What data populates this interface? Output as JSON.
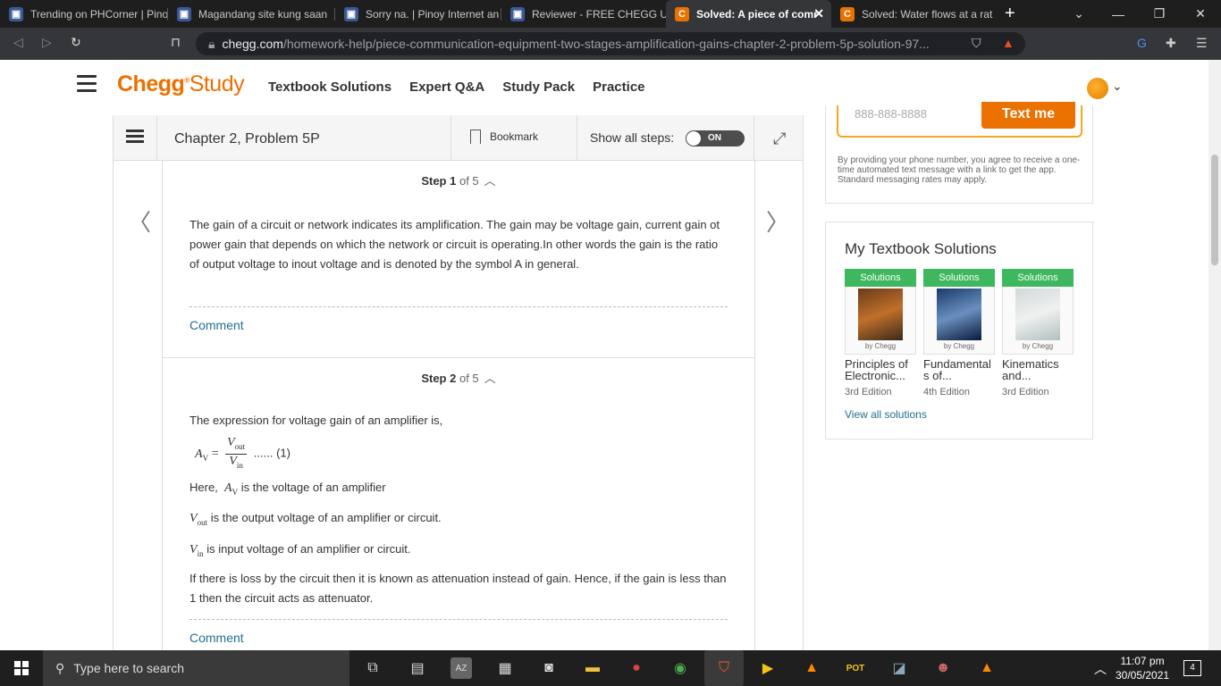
{
  "browser": {
    "tabs": [
      {
        "title": "Trending on PHCorner | Pinoy",
        "favicon": "phcorner-icon"
      },
      {
        "title": "Magandang site kung saan",
        "favicon": "phcorner-icon"
      },
      {
        "title": "Sorry na. | Pinoy Internet an",
        "favicon": "phcorner-icon"
      },
      {
        "title": "Reviewer - FREE CHEGG UN",
        "favicon": "phcorner-icon"
      },
      {
        "title": "Solved: A piece of comm",
        "favicon": "chegg-icon",
        "active": true
      },
      {
        "title": "Solved: Water flows at a rat",
        "favicon": "chegg-icon"
      }
    ],
    "url_domain": "chegg.com",
    "url_path": "/homework-help/piece-communication-equipment-two-stages-amplification-gains-chapter-2-problem-5p-solution-97..."
  },
  "header": {
    "logo_main": "Chegg",
    "logo_sub": "Study",
    "nav": [
      "Textbook Solutions",
      "Expert Q&A",
      "Study Pack",
      "Practice"
    ]
  },
  "solution_bar": {
    "chapter": "Chapter 2, Problem 5P",
    "bookmark": "Bookmark",
    "show_all_steps": "Show all steps:",
    "toggle": "ON"
  },
  "steps": [
    {
      "label": "Step",
      "num": "1",
      "of": "of 5",
      "body": "The gain of a circuit or network indicates its amplification. The gain may be voltage gain, current gain ot power gain that depends on which the network or circuit is operating.In other words the gain is the ratio of output voltage to inout voltage and is denoted by the symbol A in general.",
      "comment": "Comment"
    },
    {
      "label": "Step",
      "num": "2",
      "of": "of 5",
      "intro": "The expression for voltage gain of an amplifier is,",
      "eq_lhs": "A",
      "eq_lhs_sub": "V",
      "eq_num": "V",
      "eq_num_sub": "out",
      "eq_den": "V",
      "eq_den_sub": "in",
      "eq_tag": "...... (1)",
      "here_prefix": "Here,",
      "line1": "is the voltage of an amplifier",
      "line2": "is the output voltage of an amplifier or circuit.",
      "line3": "is input voltage of an amplifier or circuit.",
      "outro": "If there is loss by the circuit then it is known as attenuation instead of gain. Hence, if the gain is less than 1 then the circuit acts as attenuator.",
      "comment": "Comment"
    }
  ],
  "sidebar": {
    "phone_placeholder": "888-888-8888",
    "text_me": "Text me",
    "disclaimer": "By providing your phone number, you agree to receive a one-time automated text message with a link to get the app. Standard messaging rates may apply.",
    "my_solutions_title": "My Textbook Solutions",
    "books": [
      {
        "badge": "Solutions",
        "by": "by Chegg",
        "title1": "Principles of",
        "title2": "Electronic...",
        "edition": "3rd Edition"
      },
      {
        "badge": "Solutions",
        "by": "by Chegg",
        "title1": "Fundamental",
        "title2": "s of...",
        "edition": "4th Edition"
      },
      {
        "badge": "Solutions",
        "by": "by Chegg",
        "title1": "Kinematics",
        "title2": "and...",
        "edition": "3rd Edition"
      }
    ],
    "view_all": "View all solutions"
  },
  "taskbar": {
    "search_placeholder": "Type here to search",
    "time": "11:07 pm",
    "date": "30/05/2021",
    "notifications": "4"
  },
  "colors": {
    "chegg_orange": "#eb7100",
    "solutions_green": "#3eb75e",
    "link_blue": "#236e8f"
  }
}
